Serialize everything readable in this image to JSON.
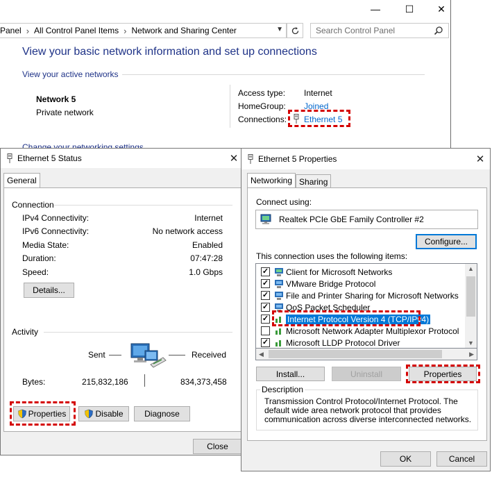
{
  "background_window": {
    "caption": {
      "minimize": "—",
      "maximize": "☐",
      "close": "✕"
    },
    "breadcrumb": [
      "Panel",
      "All Control Panel Items",
      "Network and Sharing Center"
    ],
    "search_placeholder": "Search Control Panel",
    "heading": "View your basic network information and set up connections",
    "active_networks_label": "View your active networks",
    "network_name": "Network  5",
    "network_type": "Private network",
    "access_type_label": "Access type:",
    "access_type_value": "Internet",
    "homegroup_label": "HomeGroup:",
    "homegroup_value": "Joined",
    "connections_label": "Connections:",
    "connections_value": "Ethernet 5",
    "change_settings": "Change your networking settings"
  },
  "status_dialog": {
    "title": "Ethernet 5 Status",
    "close": "✕",
    "tab": "General",
    "connection_group": "Connection",
    "rows": [
      {
        "label": "IPv4 Connectivity:",
        "value": "Internet"
      },
      {
        "label": "IPv6 Connectivity:",
        "value": "No network access"
      },
      {
        "label": "Media State:",
        "value": "Enabled"
      },
      {
        "label": "Duration:",
        "value": "07:47:28"
      },
      {
        "label": "Speed:",
        "value": "1.0 Gbps"
      }
    ],
    "details_button": "Details...",
    "activity_group": "Activity",
    "sent_label": "Sent",
    "received_label": "Received",
    "bytes_label": "Bytes:",
    "bytes_sent": "215,832,186",
    "bytes_received": "834,373,458",
    "properties_button": "Properties",
    "disable_button": "Disable",
    "diagnose_button": "Diagnose",
    "close_button": "Close"
  },
  "properties_dialog": {
    "title": "Ethernet 5 Properties",
    "close": "✕",
    "tabs": [
      "Networking",
      "Sharing"
    ],
    "connect_using_label": "Connect using:",
    "adapter_name": "Realtek PCIe GbE Family Controller #2",
    "configure_button": "Configure...",
    "items_label": "This connection uses the following items:",
    "items": [
      {
        "label": "Client for Microsoft Networks",
        "checked": true
      },
      {
        "label": "VMware Bridge Protocol",
        "checked": true
      },
      {
        "label": "File and Printer Sharing for Microsoft Networks",
        "checked": true
      },
      {
        "label": "QoS Packet Scheduler",
        "checked": true
      },
      {
        "label": "Internet Protocol Version 4 (TCP/IPv4)",
        "checked": true,
        "selected": true
      },
      {
        "label": "Microsoft Network Adapter Multiplexor Protocol",
        "checked": false
      },
      {
        "label": "Microsoft LLDP Protocol Driver",
        "checked": true
      }
    ],
    "install_button": "Install...",
    "uninstall_button": "Uninstall",
    "properties_button": "Properties",
    "description_group": "Description",
    "description_text": "Transmission Control Protocol/Internet Protocol. The default wide area network protocol that provides communication across diverse interconnected networks.",
    "ok_button": "OK",
    "cancel_button": "Cancel",
    "check_mark": "✓"
  },
  "colors": {
    "heading_blue": "#1e3287",
    "link_blue": "#0066cc",
    "highlight_red": "#d40000",
    "selection_blue": "#0078d7"
  }
}
